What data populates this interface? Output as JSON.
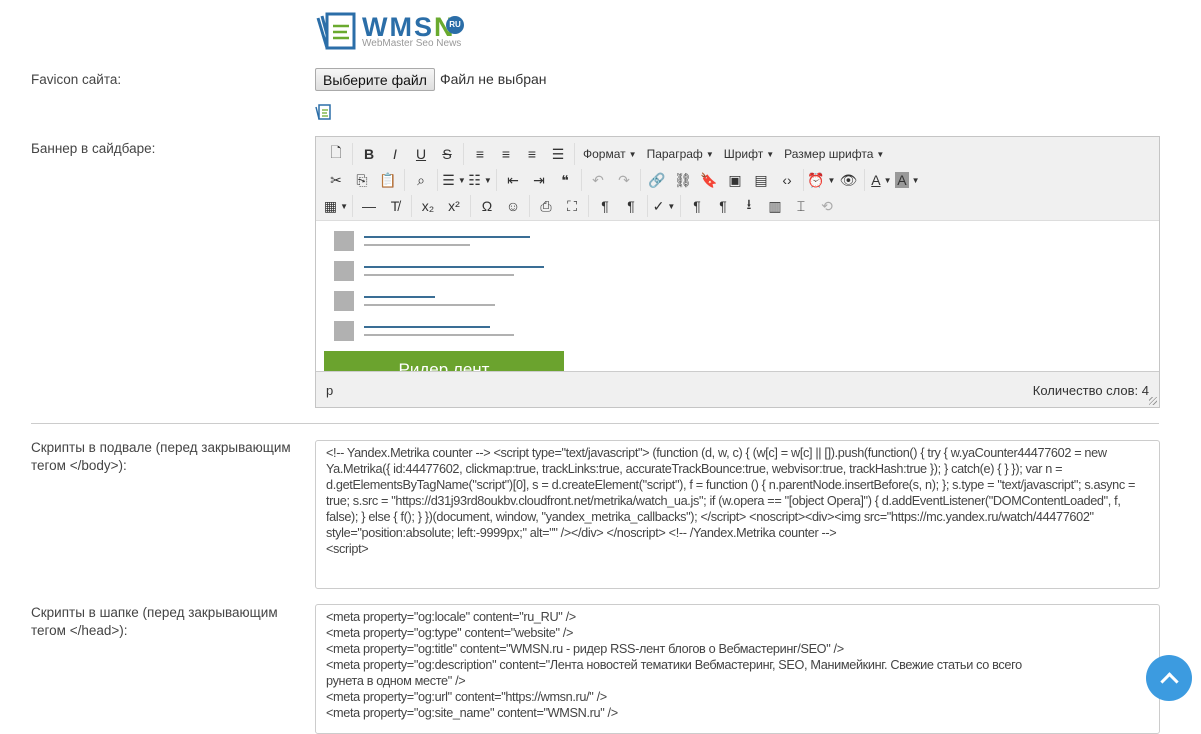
{
  "logo": {
    "brand_a": "WMS",
    "brand_b": "N",
    "badge": "RU",
    "tagline": "WebMaster Seo News"
  },
  "favicon": {
    "label": "Favicon сайта:",
    "button": "Выберите файл",
    "status": "Файл не выбран"
  },
  "banner": {
    "label": "Баннер в сайдбаре:",
    "toolbar": [
      [
        [
          {
            "icon": "new-document-icon",
            "glyph": "🗋"
          }
        ],
        [
          {
            "icon": "bold-icon",
            "glyph": "B"
          },
          {
            "icon": "italic-icon",
            "glyph": "I"
          },
          {
            "icon": "underline-icon",
            "glyph": "U"
          },
          {
            "icon": "strikethrough-icon",
            "glyph": "S"
          }
        ],
        [
          {
            "icon": "align-left-icon",
            "glyph": "≡"
          },
          {
            "icon": "align-center-icon",
            "glyph": "≡"
          },
          {
            "icon": "align-right-icon",
            "glyph": "≡"
          },
          {
            "icon": "justify-icon",
            "glyph": "☰"
          }
        ],
        [
          {
            "label": "Формат",
            "dropdown": true
          },
          {
            "label": "Параграф",
            "dropdown": true
          },
          {
            "label": "Шрифт",
            "dropdown": true
          },
          {
            "label": "Размер шрифта",
            "dropdown": true
          }
        ]
      ],
      [
        [
          {
            "icon": "cut-icon",
            "glyph": "✂"
          },
          {
            "icon": "copy-icon",
            "glyph": "⎘"
          },
          {
            "icon": "paste-icon",
            "glyph": "📋"
          }
        ],
        [
          {
            "icon": "find-replace-icon",
            "glyph": "⌕"
          }
        ],
        [
          {
            "icon": "bullet-list-icon",
            "glyph": "☰",
            "dropdown": true
          },
          {
            "icon": "numbered-list-icon",
            "glyph": "☷",
            "dropdown": true
          }
        ],
        [
          {
            "icon": "outdent-icon",
            "glyph": "⇤"
          },
          {
            "icon": "indent-icon",
            "glyph": "⇥"
          },
          {
            "icon": "blockquote-icon",
            "glyph": "❝"
          }
        ],
        [
          {
            "icon": "undo-icon",
            "glyph": "↶",
            "disabled": true
          },
          {
            "icon": "redo-icon",
            "glyph": "↷",
            "disabled": true
          }
        ],
        [
          {
            "icon": "link-icon",
            "glyph": "🔗"
          },
          {
            "icon": "unlink-icon",
            "glyph": "⛓"
          },
          {
            "icon": "bookmark-icon",
            "glyph": "🔖"
          },
          {
            "icon": "image-icon",
            "glyph": "▣"
          },
          {
            "icon": "media-icon",
            "glyph": "▤"
          },
          {
            "icon": "code-icon",
            "glyph": "‹›"
          }
        ],
        [
          {
            "icon": "insert-datetime-icon",
            "glyph": "⏰",
            "dropdown": true
          },
          {
            "icon": "preview-icon",
            "glyph": "👁"
          }
        ],
        [
          {
            "icon": "text-color-icon",
            "glyph": "A",
            "dropdown": true
          },
          {
            "icon": "background-color-icon",
            "glyph": "A",
            "dropdown": true
          }
        ]
      ],
      [
        [
          {
            "icon": "table-icon",
            "glyph": "▦",
            "dropdown": true
          }
        ],
        [
          {
            "icon": "horizontal-line-icon",
            "glyph": "—"
          },
          {
            "icon": "clear-format-icon",
            "glyph": "T̸"
          }
        ],
        [
          {
            "icon": "subscript-icon",
            "glyph": "x₂"
          },
          {
            "icon": "superscript-icon",
            "glyph": "x²"
          }
        ],
        [
          {
            "icon": "special-char-icon",
            "glyph": "Ω"
          },
          {
            "icon": "emoticons-icon",
            "glyph": "☺"
          }
        ],
        [
          {
            "icon": "print-icon",
            "glyph": "⎙"
          },
          {
            "icon": "fullscreen-icon",
            "glyph": "⛶"
          }
        ],
        [
          {
            "icon": "ltr-icon",
            "glyph": "¶"
          },
          {
            "icon": "rtl-icon",
            "glyph": "¶"
          }
        ],
        [
          {
            "icon": "spellcheck-icon",
            "glyph": "✓",
            "dropdown": true
          }
        ],
        [
          {
            "icon": "show-blocks-icon",
            "glyph": "¶"
          },
          {
            "icon": "visual-chars-icon",
            "glyph": "¶"
          },
          {
            "icon": "upload-icon",
            "glyph": "⭳"
          },
          {
            "icon": "template-icon",
            "glyph": "▥"
          },
          {
            "icon": "page-break-icon",
            "glyph": "⌶"
          },
          {
            "icon": "restore-draft-icon",
            "glyph": "⟲",
            "disabled": true
          }
        ]
      ]
    ],
    "content_button": "Ридер лент",
    "status_path": "p",
    "word_count": "Количество слов: 4"
  },
  "footer_scripts": {
    "label": "Скрипты в подвале (перед закрывающим тегом </body>):",
    "value": "<!-- Yandex.Metrika counter --> <script type=\"text/javascript\"> (function (d, w, c) { (w[c] = w[c] || []).push(function() { try { w.yaCounter44477602 = new Ya.Metrika({ id:44477602, clickmap:true, trackLinks:true, accurateTrackBounce:true, webvisor:true, trackHash:true }); } catch(e) { } }); var n = d.getElementsByTagName(\"script\")[0], s = d.createElement(\"script\"), f = function () { n.parentNode.insertBefore(s, n); }; s.type = \"text/javascript\"; s.async = true; s.src = \"https://d31j93rd8oukbv.cloudfront.net/metrika/watch_ua.js\"; if (w.opera == \"[object Opera]\") { d.addEventListener(\"DOMContentLoaded\", f, false); } else { f(); } })(document, window, \"yandex_metrika_callbacks\"); </script> <noscript><div><img src=\"https://mc.yandex.ru/watch/44477602\" style=\"position:absolute; left:-9999px;\" alt=\"\" /></div> </noscript> <!-- /Yandex.Metrika counter -->",
    "value_tail": "<script>"
  },
  "header_scripts": {
    "label": "Скрипты в шапке (перед закрывающим тегом </head>):",
    "lines": [
      "<meta property=\"og:locale\" content=\"ru_RU\" />",
      "<meta property=\"og:type\" content=\"website\" />",
      "<meta property=\"og:title\" content=\"WMSN.ru - ридер RSS-лент блогов о Вебмастеринг/SEO\" />",
      "<meta property=\"og:description\" content=\"Лента новостей тематики Вебмастеринг, SEO, Манимейкинг. Свежие статьи со всего",
      "рунета в одном месте\" />",
      "<meta property=\"og:url\" content=\"https://wmsn.ru/\" />",
      "<meta property=\"og:site_name\" content=\"WMSN.ru\" />"
    ]
  }
}
